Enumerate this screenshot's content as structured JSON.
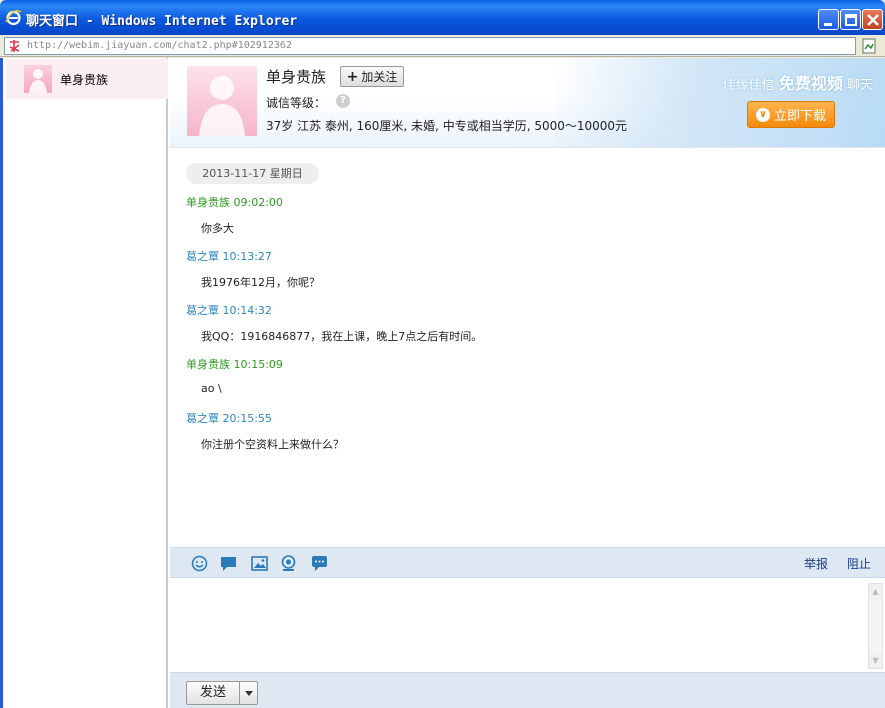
{
  "window": {
    "title": "聊天窗口 - Windows Internet Explorer"
  },
  "addressbar": {
    "url": "http://webim.jiayuan.com/chat2.php#102912362"
  },
  "sidebar": {
    "contacts": [
      {
        "name": "单身贵族"
      }
    ]
  },
  "profile": {
    "name": "单身贵族",
    "follow_label": "加关注",
    "credit_label": "诚信等级：",
    "info": "37岁 江苏 泰州, 160厘米, 未婚, 中专或相当学历, 5000～10000元",
    "promo_prefix": "佳缘佳信",
    "promo_highlight": "免费视频",
    "promo_suffix": "聊天",
    "download_label": "立即下载"
  },
  "chat": {
    "date": "2013-11-17 星期日",
    "messages": [
      {
        "sender": "单身贵族",
        "time": "09:02:00",
        "text": "你多大"
      },
      {
        "sender": "葛之覃",
        "time": "10:13:27",
        "text": "我1976年12月，你呢？"
      },
      {
        "sender": "葛之覃",
        "time": "10:14:32",
        "text": "我QQ：1916846877，我在上课，晚上7点之后有时间。"
      },
      {
        "sender": "单身贵族",
        "time": "10:15:09",
        "text": "ao \\"
      },
      {
        "sender": "葛之覃",
        "time": "20:15:55",
        "text": "你注册个空资料上来做什么？"
      }
    ]
  },
  "toolbar": {
    "tools": [
      "smiley-icon",
      "chat-bubble-icon",
      "image-icon",
      "webcam-icon",
      "message-icon"
    ],
    "report_label": "举报",
    "block_label": "阻止"
  },
  "composer": {
    "send_label": "发送"
  },
  "colors": {
    "titlebar": "#0b59e0",
    "self_name": "#2f9a22",
    "other_name": "#2f86c0",
    "toolbar_bg": "#dde8f3",
    "download_button": "#f48a0c"
  }
}
